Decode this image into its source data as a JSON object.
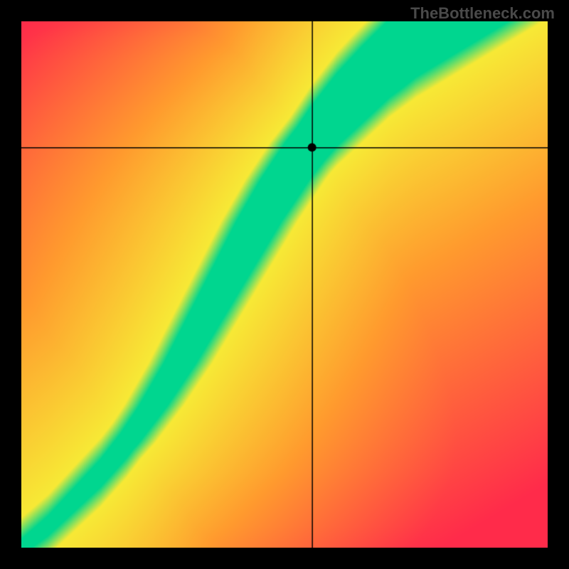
{
  "watermark": "TheBottleneck.com",
  "chart_data": {
    "type": "heatmap",
    "title": "",
    "xlabel": "",
    "ylabel": "",
    "xlim": [
      0,
      1
    ],
    "ylim": [
      0,
      1
    ],
    "marker": {
      "x": 0.553,
      "y": 0.76
    },
    "crosshair": {
      "x": 0.553,
      "y": 0.76
    },
    "optimal_curve": {
      "description": "Green optimal-balance ridge rising from bottom-left to upper area with S-curve shape",
      "points": [
        {
          "x": 0.0,
          "y": 0.0
        },
        {
          "x": 0.05,
          "y": 0.04
        },
        {
          "x": 0.1,
          "y": 0.09
        },
        {
          "x": 0.15,
          "y": 0.14
        },
        {
          "x": 0.2,
          "y": 0.2
        },
        {
          "x": 0.25,
          "y": 0.27
        },
        {
          "x": 0.3,
          "y": 0.35
        },
        {
          "x": 0.35,
          "y": 0.44
        },
        {
          "x": 0.4,
          "y": 0.53
        },
        {
          "x": 0.45,
          "y": 0.62
        },
        {
          "x": 0.5,
          "y": 0.7
        },
        {
          "x": 0.55,
          "y": 0.77
        },
        {
          "x": 0.6,
          "y": 0.83
        },
        {
          "x": 0.65,
          "y": 0.88
        },
        {
          "x": 0.7,
          "y": 0.93
        },
        {
          "x": 0.75,
          "y": 0.97
        },
        {
          "x": 0.8,
          "y": 1.0
        }
      ]
    },
    "color_scale": {
      "optimal": "#00d68f",
      "near": "#f7e935",
      "mid": "#ff9a2e",
      "far": "#ff2b4a"
    },
    "ridge_width_start": 0.015,
    "ridge_width_end": 0.075
  }
}
